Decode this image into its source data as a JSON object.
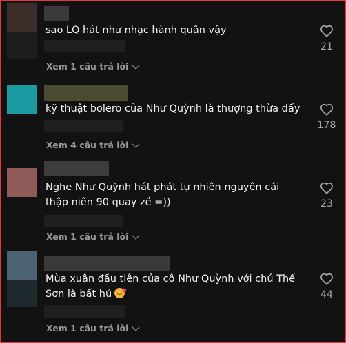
{
  "comments": [
    {
      "text": "sao LQ hát như nhạc hành quân vậy",
      "likes": "21",
      "replies_label": "Xem 1 câu trả lời",
      "avatar_colors": [
        "#3b2d2a",
        "#1d1d1d"
      ],
      "name_color": "#3a3a3a"
    },
    {
      "text": "kỹ thuật bolero của Như Quỳnh là thượng thừa đấy",
      "likes": "178",
      "replies_label": "Xem 4 câu trả lời",
      "avatar_colors": [
        "#1c9aa2",
        "#1a1a1a"
      ],
      "name_color": "#4a4a30"
    },
    {
      "text": "Nghe Như Quỳnh hát phát tự nhiên nguyên cái thập niên 90 quay zề =))",
      "likes": "23",
      "replies_label": "Xem 1 câu trả lời",
      "avatar_colors": [
        "#8f5a58",
        "#1a1a1a"
      ],
      "name_color": "#3d3d3d"
    },
    {
      "text": "Mùa xuân đầu tiên của cô Như Quỳnh với chú Thế Sơn là bất hủ",
      "likes": "44",
      "replies_label": "Xem 1 câu trả lời",
      "avatar_colors": [
        "#4d6272",
        "#1f2a2e"
      ],
      "name_color": "#3a3a3a",
      "emoji": "smiling-face-with-hearts-emoji"
    }
  ],
  "colors": {
    "background": "#121212",
    "text": "#f2f2f2",
    "muted": "#9a9a9a",
    "border": "#e23a3a"
  }
}
